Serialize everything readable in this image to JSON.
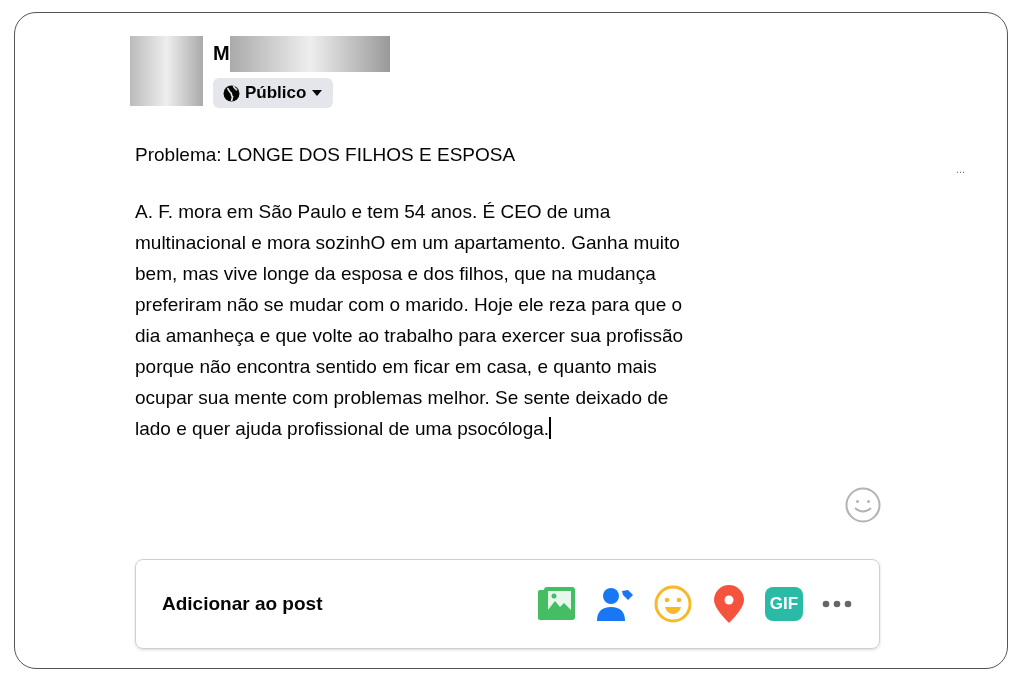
{
  "author": {
    "name_visible": "M",
    "privacy": "Público"
  },
  "post": {
    "title": "Problema: LONGE DOS FILHOS E ESPOSA",
    "body": "A. F. mora em São Paulo e tem 54 anos. É CEO de uma\nmultinacional e mora sozinhO em um apartamento. Ganha muito\nbem, mas vive longe da esposa e dos filhos, que na mudança\npreferiram não se mudar com o marido. Hoje ele reza para que o\ndia amanheça e que volte ao trabalho para exercer sua profissão\nporque não encontra sentido em ficar em casa, e quanto mais\nocupar sua mente com problemas melhor. Se sente deixado de\nlado e quer ajuda profissional de uma psocóloga.",
    "side_menu": "...",
    "focused": true
  },
  "add_to_post": {
    "label": "Adicionar ao post",
    "gif": "GIF"
  }
}
